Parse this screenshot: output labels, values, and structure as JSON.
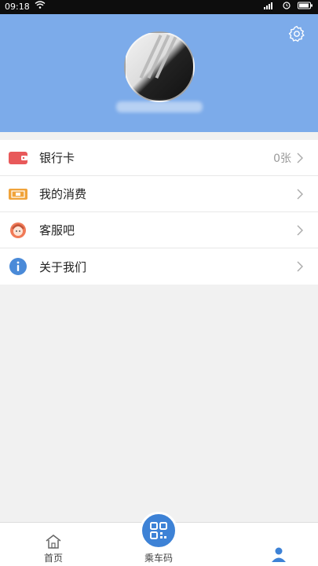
{
  "status_bar": {
    "time": "09:18"
  },
  "menu": {
    "items": [
      {
        "label": "银行卡",
        "value": "0张"
      },
      {
        "label": "我的消费",
        "value": ""
      },
      {
        "label": "客服吧",
        "value": ""
      },
      {
        "label": "关于我们",
        "value": ""
      }
    ]
  },
  "tabbar": {
    "home_label": "首页",
    "center_label": "乘车码"
  },
  "colors": {
    "header_bg": "#7cabea",
    "accent": "#3d82d6"
  }
}
